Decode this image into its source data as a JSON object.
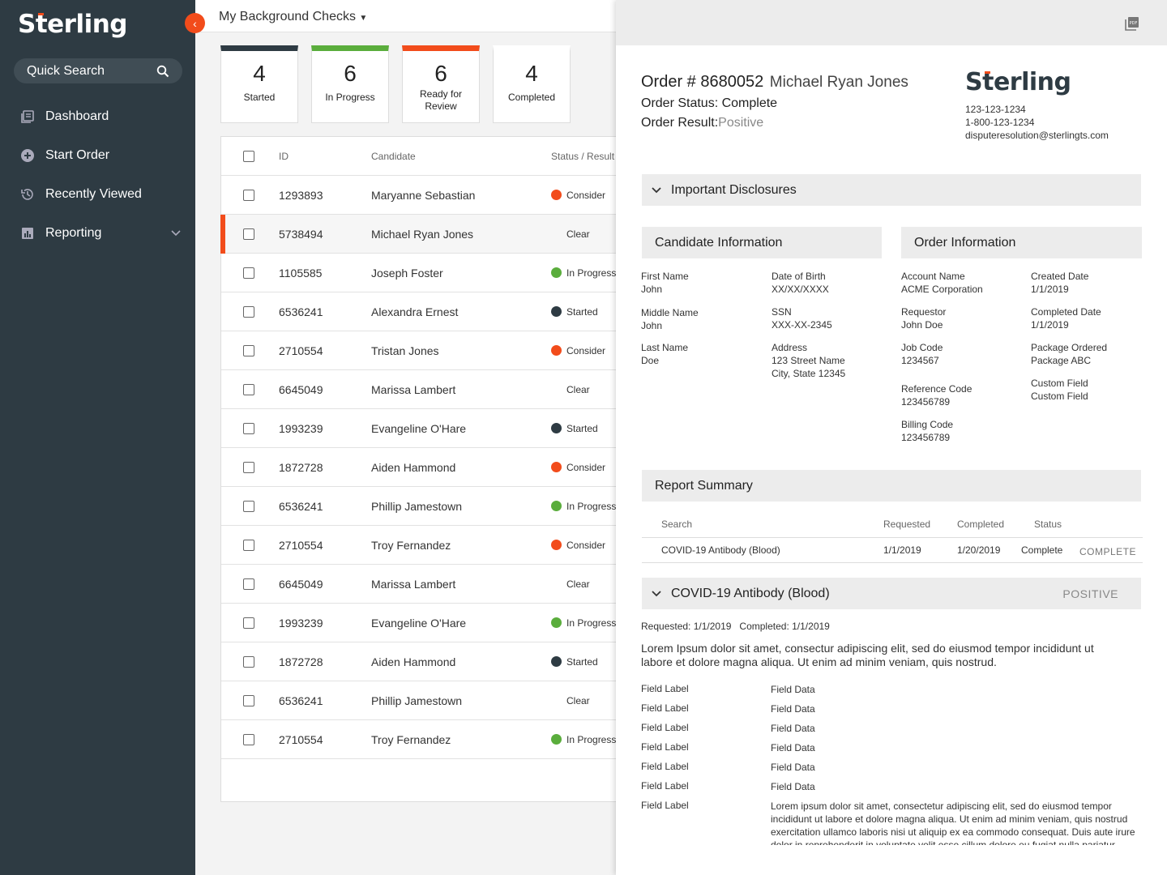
{
  "sidebar": {
    "logo": "Sterling",
    "quick_search": "Quick Search",
    "items": [
      {
        "label": "Dashboard",
        "icon": "dashboard-icon"
      },
      {
        "label": "Start Order",
        "icon": "plus-circle-icon"
      },
      {
        "label": "Recently Viewed",
        "icon": "history-icon"
      },
      {
        "label": "Reporting",
        "icon": "bar-chart-icon"
      }
    ]
  },
  "main": {
    "title": "My Background Checks",
    "cards": [
      {
        "count": "4",
        "label": "Started"
      },
      {
        "count": "6",
        "label": "In Progress"
      },
      {
        "count": "6",
        "label": "Ready for Review"
      },
      {
        "count": "4",
        "label": "Completed"
      }
    ],
    "table": {
      "headers": {
        "id": "ID",
        "candidate": "Candidate",
        "status": "Status / Result"
      },
      "rows": [
        {
          "id": "1293893",
          "name": "Maryanne Sebastian",
          "status": "Consider",
          "color": "#f24c1b"
        },
        {
          "id": "5738494",
          "name": "Michael Ryan Jones",
          "status": "Clear",
          "color": ""
        },
        {
          "id": "1105585",
          "name": "Joseph Foster",
          "status": "In Progress",
          "color": "#5aad3c"
        },
        {
          "id": "6536241",
          "name": "Alexandra Ernest",
          "status": "Started",
          "color": "#2e3b43"
        },
        {
          "id": "2710554",
          "name": "Tristan Jones",
          "status": "Consider",
          "color": "#f24c1b"
        },
        {
          "id": "6645049",
          "name": "Marissa Lambert",
          "status": "Clear",
          "color": ""
        },
        {
          "id": "1993239",
          "name": "Evangeline O'Hare",
          "status": "Started",
          "color": "#2e3b43"
        },
        {
          "id": "1872728",
          "name": "Aiden Hammond",
          "status": "Consider",
          "color": "#f24c1b"
        },
        {
          "id": "6536241",
          "name": "Phillip Jamestown",
          "status": "In Progress",
          "color": "#5aad3c"
        },
        {
          "id": "2710554",
          "name": "Troy Fernandez",
          "status": "Consider",
          "color": "#f24c1b"
        },
        {
          "id": "6645049",
          "name": "Marissa Lambert",
          "status": "Clear",
          "color": ""
        },
        {
          "id": "1993239",
          "name": "Evangeline O'Hare",
          "status": "In Progress",
          "color": "#5aad3c"
        },
        {
          "id": "1872728",
          "name": "Aiden Hammond",
          "status": "Started",
          "color": "#2e3b43"
        },
        {
          "id": "6536241",
          "name": "Phillip Jamestown",
          "status": "Clear",
          "color": ""
        },
        {
          "id": "2710554",
          "name": "Troy Fernandez",
          "status": "In Progress",
          "color": "#5aad3c"
        }
      ]
    }
  },
  "panel": {
    "order_label": "Order # 8680052",
    "candidate_name": "Michael Ryan Jones",
    "status_line": "Order Status: Complete",
    "result_label": "Order Result:",
    "result_value": "Positive",
    "brand": "Sterling",
    "phone1": "123-123-1234",
    "phone2": "1-800-123-1234",
    "email": "disputeresolution@sterlingts.com",
    "disclosures": "Important Disclosures",
    "candidate_info": {
      "title": "Candidate Information",
      "first_name_label": "First Name",
      "first_name": "John",
      "dob_label": "Date of Birth",
      "dob": "XX/XX/XXXX",
      "middle_name_label": "Middle Name",
      "middle_name": "John",
      "ssn_label": "SSN",
      "ssn": "XXX-XX-2345",
      "last_name_label": "Last Name",
      "last_name": "Doe",
      "address_label": "Address",
      "address1": "123 Street Name",
      "address2": "City, State 12345"
    },
    "order_info": {
      "title": "Order Information",
      "account_label": "Account Name",
      "account": "ACME Corporation",
      "created_label": "Created Date",
      "created": "1/1/2019",
      "requestor_label": "Requestor",
      "requestor": "John Doe",
      "completed_label": "Completed Date",
      "completed": "1/1/2019",
      "job_label": "Job Code",
      "job": "1234567",
      "package_label": "Package Ordered",
      "package": "Package ABC",
      "reference_label": "Reference Code",
      "reference": "123456789",
      "custom_label": "Custom Field",
      "custom": "Custom Field",
      "billing_label": "Billing Code",
      "billing": "123456789"
    },
    "report_summary": {
      "title": "Report Summary",
      "headers": {
        "search": "Search",
        "requested": "Requested",
        "completed": "Completed",
        "status": "Status"
      },
      "row": {
        "search": "COVID-19 Antibody (Blood)",
        "requested": "1/1/2019",
        "completed": "1/20/2019",
        "status": "Complete",
        "result": "COMPLETE"
      }
    },
    "covid": {
      "title": "COVID-19 Antibody (Blood)",
      "result": "POSITIVE",
      "dates": "Requested: 1/1/2019   Completed: 1/1/2019",
      "description": "Lorem Ipsum dolor sit amet, consectur adipiscing elit, sed do eiusmod tempor incididunt ut labore et dolore magna aliqua. Ut enim ad minim veniam, quis nostrud.",
      "fields": [
        {
          "label": "Field Label",
          "value": "Field Data"
        },
        {
          "label": "Field Label",
          "value": "Field Data"
        },
        {
          "label": "Field Label",
          "value": "Field Data"
        },
        {
          "label": "Field Label",
          "value": "Field Data"
        },
        {
          "label": "Field Label",
          "value": "Field Data"
        },
        {
          "label": "Field Label",
          "value": "Field Data"
        },
        {
          "label": "Field Label",
          "value": "Lorem ipsum dolor sit amet, consectetur adipiscing elit, sed do eiusmod tempor incididunt ut labore et dolore magna aliqua. Ut enim ad minim veniam, quis nostrud exercitation ullamco laboris nisi ut aliquip ex ea commodo consequat. Duis aute irure dolor in reprehenderit in voluptate velit esse cillum dolore eu fugiat nulla pariatur."
        }
      ]
    }
  }
}
